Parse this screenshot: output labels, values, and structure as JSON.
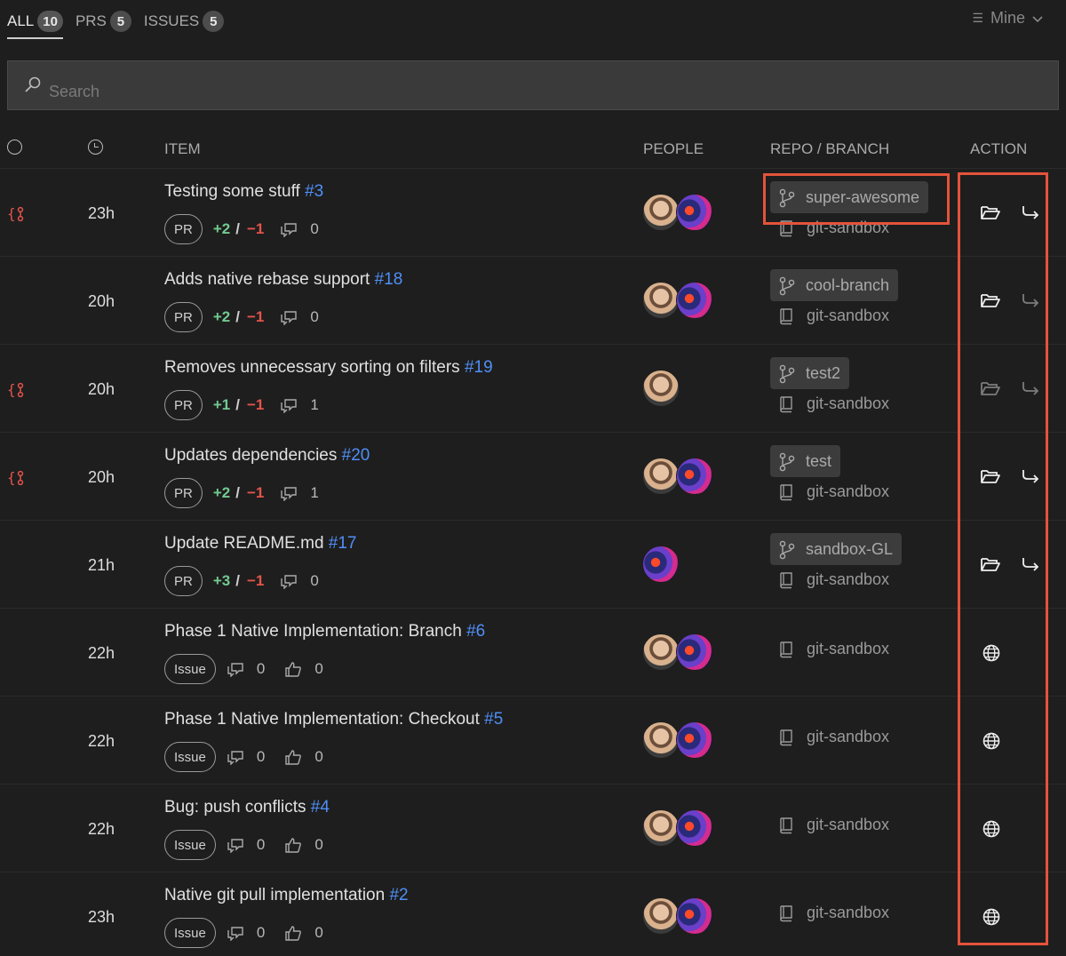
{
  "tabs": [
    {
      "label": "ALL",
      "count": "10"
    },
    {
      "label": "PRS",
      "count": "5"
    },
    {
      "label": "ISSUES",
      "count": "5"
    }
  ],
  "filter": {
    "label": "Mine"
  },
  "search": {
    "placeholder": "Search"
  },
  "columns": {
    "item": "ITEM",
    "people": "PEOPLE",
    "repo_branch": "REPO / BRANCH",
    "action": "ACTION"
  },
  "rows": [
    {
      "status_icon": "branch-conflict",
      "time": "23h",
      "title": "Testing some stuff",
      "number": "#3",
      "type": "PR",
      "additions": "+2",
      "deletions": "−1",
      "comments": "0",
      "avatars": [
        "a",
        "b"
      ],
      "branch": "super-awesome",
      "repo": "git-sandbox",
      "actions": [
        "open-folder",
        "switch-branch"
      ]
    },
    {
      "status_icon": "",
      "time": "20h",
      "title": "Adds native rebase support",
      "number": "#18",
      "type": "PR",
      "additions": "+2",
      "deletions": "−1",
      "comments": "0",
      "avatars": [
        "a",
        "b"
      ],
      "branch": "cool-branch",
      "repo": "git-sandbox",
      "actions": [
        "open-folder",
        "switch-branch-dim"
      ]
    },
    {
      "status_icon": "branch-conflict",
      "time": "20h",
      "title": "Removes unnecessary sorting on filters",
      "number": "#19",
      "type": "PR",
      "additions": "+1",
      "deletions": "−1",
      "comments": "1",
      "avatars": [
        "a"
      ],
      "branch": "test2",
      "repo": "git-sandbox",
      "actions": [
        "open-folder-dim",
        "switch-branch-dim"
      ]
    },
    {
      "status_icon": "branch-conflict",
      "time": "20h",
      "title": "Updates dependencies",
      "number": "#20",
      "type": "PR",
      "additions": "+2",
      "deletions": "−1",
      "comments": "1",
      "avatars": [
        "a",
        "b"
      ],
      "branch": "test",
      "repo": "git-sandbox",
      "actions": [
        "open-folder",
        "switch-branch"
      ]
    },
    {
      "status_icon": "",
      "time": "21h",
      "title": "Update README.md",
      "number": "#17",
      "type": "PR",
      "additions": "+3",
      "deletions": "−1",
      "comments": "0",
      "avatars": [
        "b"
      ],
      "branch": "sandbox-GL",
      "repo": "git-sandbox",
      "actions": [
        "open-folder",
        "switch-branch"
      ]
    },
    {
      "status_icon": "",
      "time": "22h",
      "title": "Phase 1 Native Implementation: Branch",
      "number": "#6",
      "type": "Issue",
      "comments": "0",
      "reactions": "0",
      "avatars": [
        "a",
        "b"
      ],
      "repo": "git-sandbox",
      "actions": [
        "globe"
      ]
    },
    {
      "status_icon": "",
      "time": "22h",
      "title": "Phase 1 Native Implementation: Checkout",
      "number": "#5",
      "type": "Issue",
      "comments": "0",
      "reactions": "0",
      "avatars": [
        "a",
        "b"
      ],
      "repo": "git-sandbox",
      "actions": [
        "globe"
      ]
    },
    {
      "status_icon": "",
      "time": "22h",
      "title": "Bug: push conflicts",
      "number": "#4",
      "type": "Issue",
      "comments": "0",
      "reactions": "0",
      "avatars": [
        "a",
        "b"
      ],
      "repo": "git-sandbox",
      "actions": [
        "globe"
      ]
    },
    {
      "status_icon": "",
      "time": "23h",
      "title": "Native git pull implementation",
      "number": "#2",
      "type": "Issue",
      "comments": "0",
      "reactions": "0",
      "avatars": [
        "a",
        "b"
      ],
      "repo": "git-sandbox",
      "actions": [
        "globe"
      ]
    }
  ],
  "colors": {
    "background": "#1e1e1e",
    "link": "#4f8ff7",
    "additions": "#73c991",
    "deletions": "#e5534b",
    "highlight": "#e4533b"
  }
}
